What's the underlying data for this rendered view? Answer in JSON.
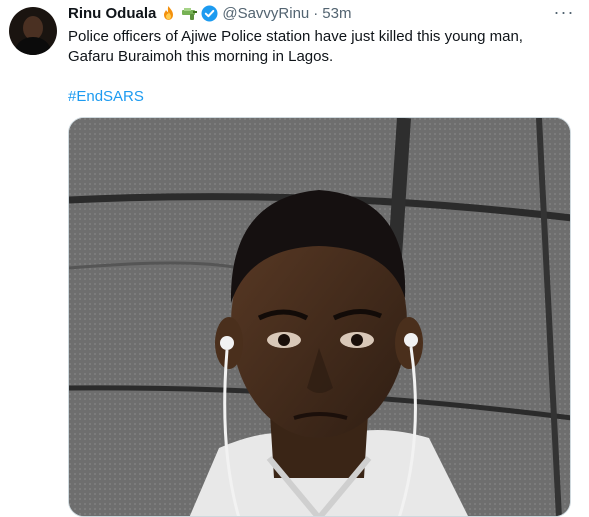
{
  "tweet": {
    "author_name": "Rinu Oduala",
    "author_emojis": [
      "fire-emoji",
      "money-gun-emoji"
    ],
    "verified": true,
    "handle": "@SavvyRinu",
    "separator": "·",
    "time": "53m",
    "more_label": "···",
    "text_lines": [
      "Police officers of Ajiwe Police station have just killed this young man,",
      "Gafaru Buraimoh this morning in Lagos."
    ],
    "hashtag": "#EndSARS",
    "media_kind": "photo"
  },
  "colors": {
    "text": "#0f1419",
    "secondary": "#536471",
    "accent": "#1d9bf0"
  }
}
